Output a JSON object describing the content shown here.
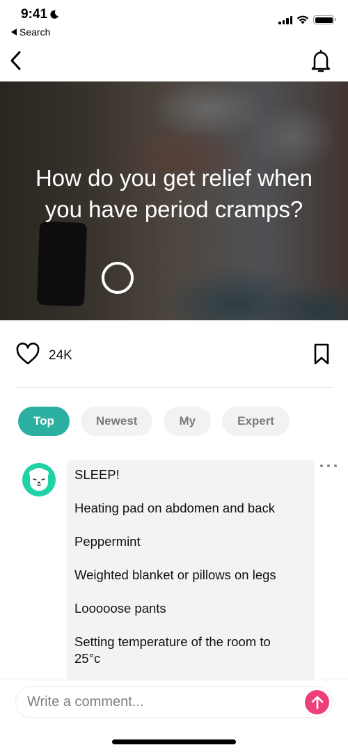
{
  "status_bar": {
    "time": "9:41",
    "back_app_label": "Search",
    "icons": [
      "moon-icon",
      "cellular-signal-icon",
      "wifi-icon",
      "battery-icon"
    ]
  },
  "nav": {
    "back_icon": "chevron-left-icon",
    "notification_icon": "bell-icon"
  },
  "hero": {
    "title": "How do you get relief when you have period cramps?",
    "image_description": "Person in white t-shirt and jeans holding stomach, phone on table"
  },
  "actions": {
    "like_icon": "heart-outline-icon",
    "like_count": "24K",
    "bookmark_icon": "bookmark-outline-icon"
  },
  "colors": {
    "accent_teal": "#2bafa0",
    "avatar_green": "#20d3a6",
    "send_pink": "#ee3f7c",
    "chip_inactive_bg": "#f2f2f4",
    "bubble_bg": "#f3f2f5"
  },
  "tabs": [
    {
      "label": "Top",
      "active": true
    },
    {
      "label": "Newest",
      "active": false
    },
    {
      "label": "My",
      "active": false
    },
    {
      "label": "Expert",
      "active": false
    }
  ],
  "comments": [
    {
      "avatar_icon": "bear-avatar-icon",
      "lines": [
        "SLEEP!",
        "Heating pad on abdomen and back",
        "Peppermint",
        "Weighted blanket or pillows on legs",
        "Looooose pants",
        "Setting temperature of the room to 25°c"
      ],
      "more_icon": "more-horizontal-icon"
    }
  ],
  "composer": {
    "placeholder": "Write a comment...",
    "value": "",
    "send_icon": "arrow-up-icon"
  }
}
